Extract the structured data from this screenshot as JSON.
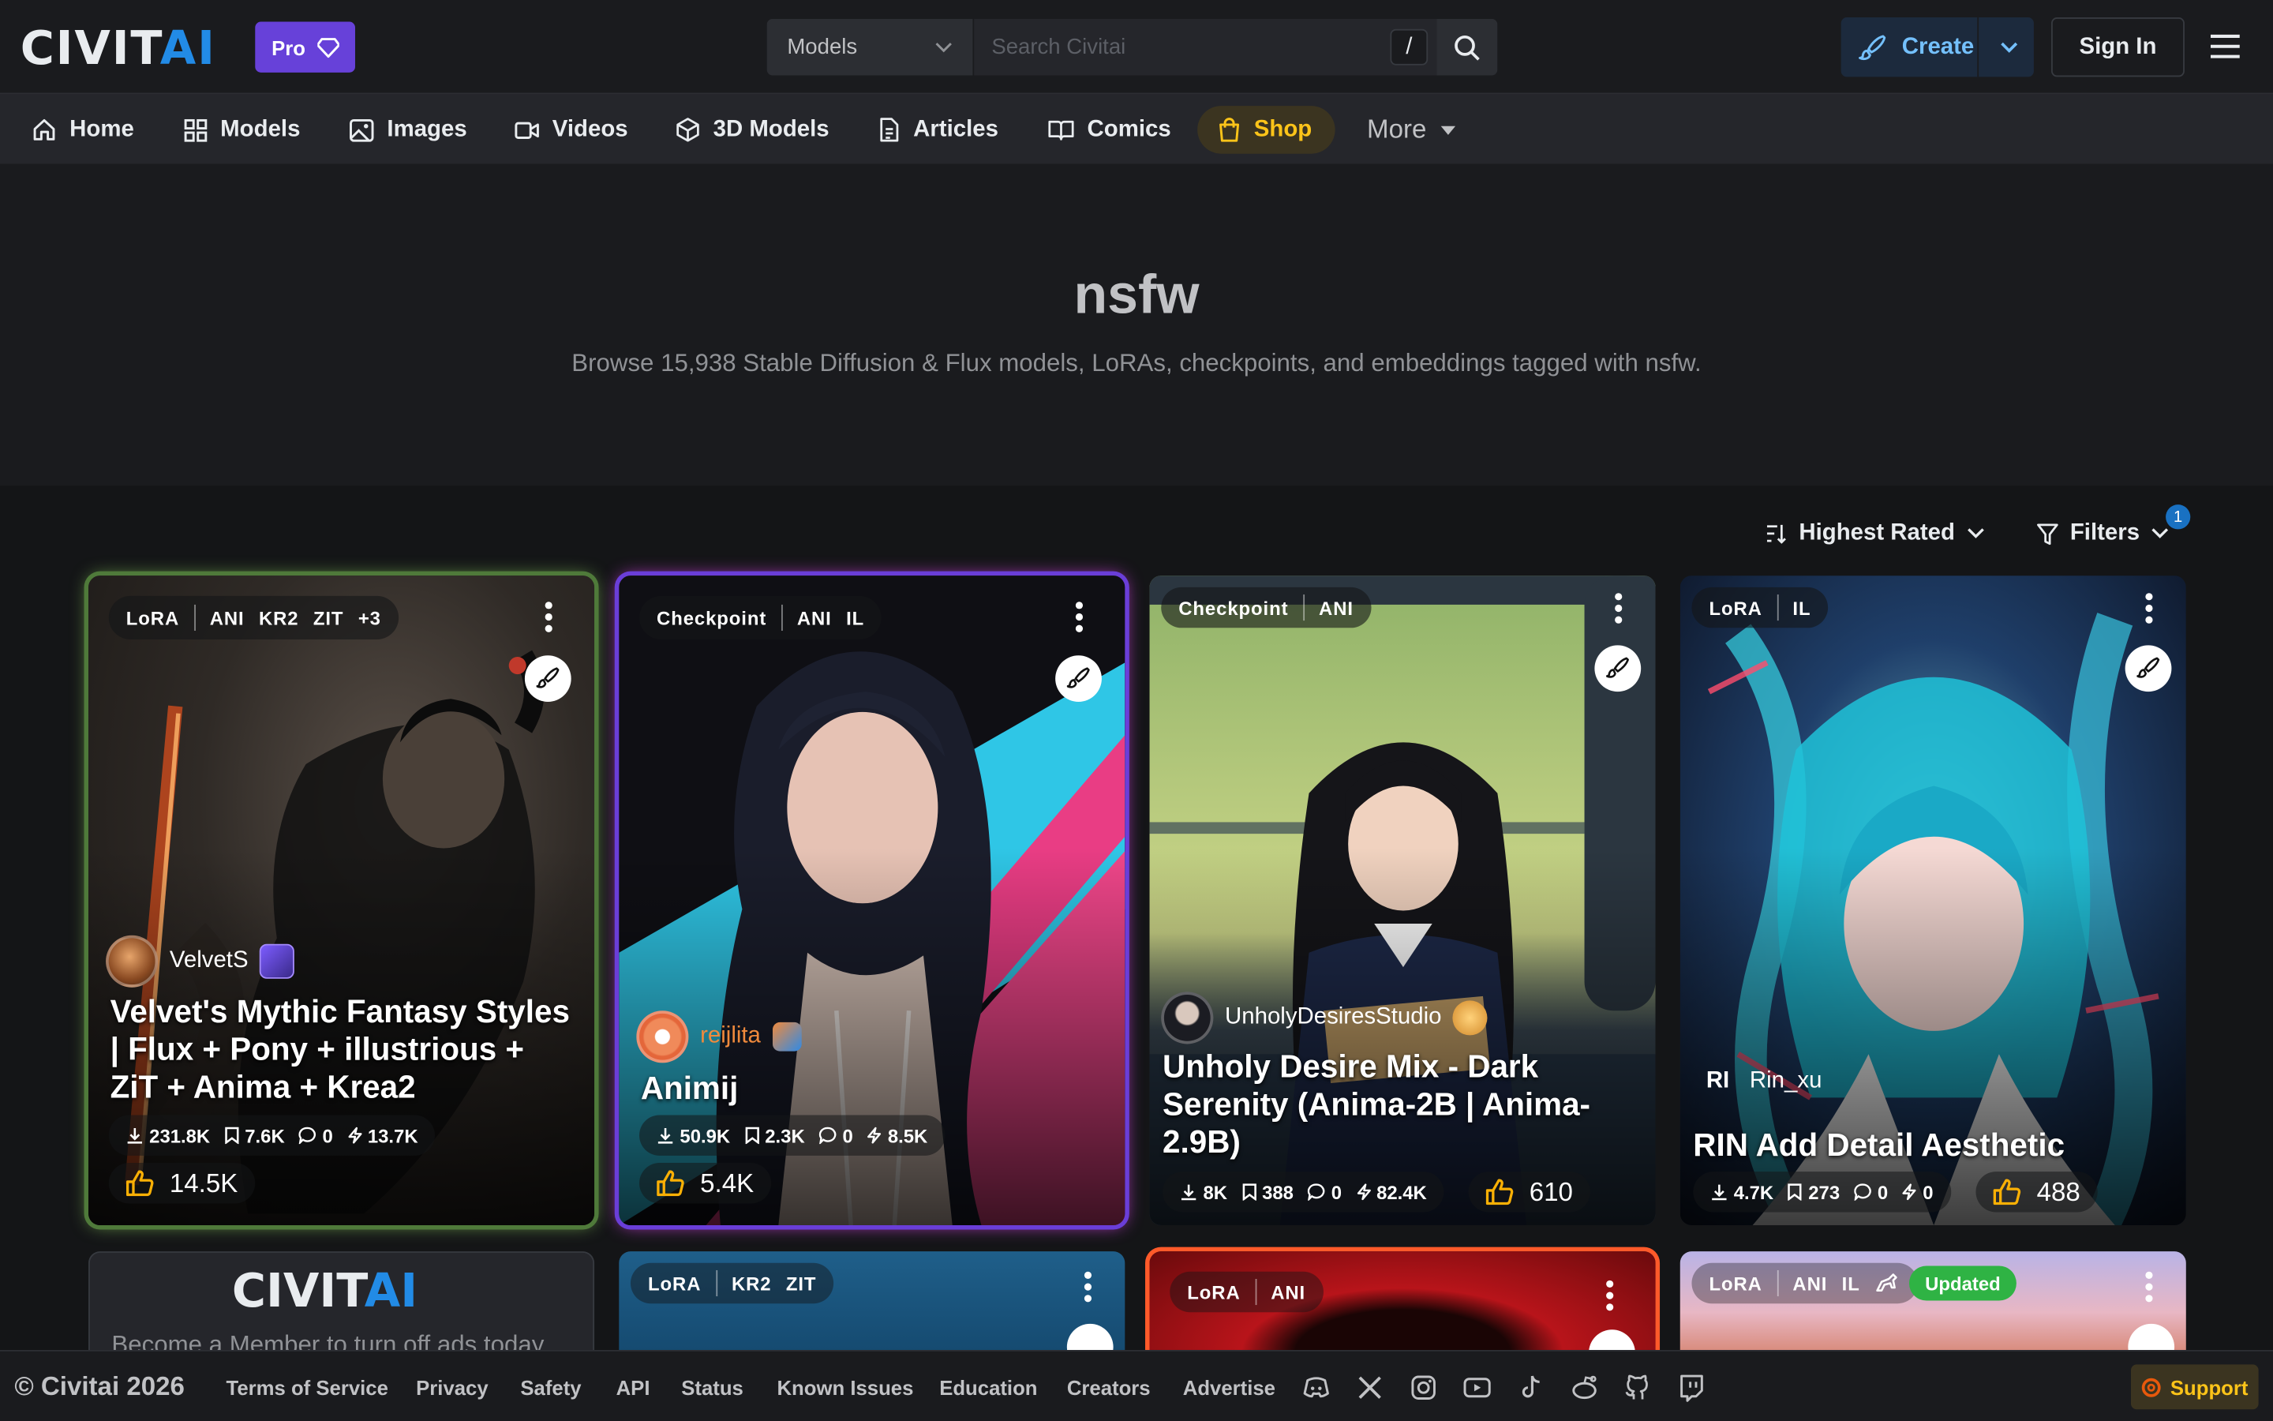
{
  "header": {
    "logo_left": "CIVIT",
    "logo_right": "AI",
    "pro_label": "Pro",
    "search_scope": "Models",
    "search_placeholder": "Search Civitai",
    "search_shortcut": "/",
    "create_label": "Create",
    "signin_label": "Sign In"
  },
  "nav": {
    "items": [
      {
        "label": "Home",
        "icon": "home-icon"
      },
      {
        "label": "Models",
        "icon": "grid-icon"
      },
      {
        "label": "Images",
        "icon": "image-icon"
      },
      {
        "label": "Videos",
        "icon": "video-icon"
      },
      {
        "label": "3D Models",
        "icon": "cube-icon"
      },
      {
        "label": "Articles",
        "icon": "article-icon"
      },
      {
        "label": "Comics",
        "icon": "book-icon"
      },
      {
        "label": "Shop",
        "icon": "shopping-bag-icon"
      }
    ],
    "more_label": "More"
  },
  "hero": {
    "title": "nsfw",
    "subtitle": "Browse 15,938 Stable Diffusion & Flux models, LoRAs, checkpoints, and embeddings tagged with nsfw."
  },
  "toolbar": {
    "sort_label": "Highest Rated",
    "filters_label": "Filters",
    "filters_count": "1"
  },
  "colors": {
    "accent": "#228be6",
    "pro": "#6741d9",
    "shop": "#fcc419",
    "like": "#fab005"
  },
  "cards": [
    {
      "type": "LoRA",
      "bases": [
        "ANI",
        "KR2",
        "ZIT",
        "+3"
      ],
      "creator": "VelvetS",
      "title": "Velvet's Mythic Fantasy Styles | Flux + Pony + illustrious + ZiT + Anima + Krea2",
      "downloads": "231.8K",
      "saves": "7.6K",
      "comments": "0",
      "buzz": "13.7K",
      "likes": "14.5K"
    },
    {
      "type": "Checkpoint",
      "bases": [
        "ANI",
        "IL"
      ],
      "creator": "reijlita",
      "title": "Animij",
      "downloads": "50.9K",
      "saves": "2.3K",
      "comments": "0",
      "buzz": "8.5K",
      "likes": "5.4K"
    },
    {
      "type": "Checkpoint",
      "bases": [
        "ANI"
      ],
      "creator": "UnholyDesiresStudio",
      "title": "Unholy Desire Mix - Dark Serenity (Anima-2B | Anima-2.9B)",
      "downloads": "8K",
      "saves": "388",
      "comments": "0",
      "buzz": "82.4K",
      "likes": "610"
    },
    {
      "type": "LoRA",
      "bases": [
        "IL"
      ],
      "creator": "Rin_xu",
      "creator_prefix": "RI",
      "title": "RIN Add Detail Aesthetic",
      "downloads": "4.7K",
      "saves": "273",
      "comments": "0",
      "buzz": "0",
      "likes": "488"
    }
  ],
  "row2": {
    "ad_text": "Become a Member to turn off ads today.",
    "card2_tags": [
      "LoRA",
      "KR2",
      "ZIT"
    ],
    "card3_tags": [
      "LoRA",
      "ANI"
    ],
    "card4_tags": [
      "LoRA",
      "ANI",
      "IL"
    ],
    "card4_badge": "Updated"
  },
  "footer": {
    "copyright": "© Civitai 2026",
    "links": [
      "Terms of Service",
      "Privacy",
      "Safety",
      "API",
      "Status",
      "Known Issues",
      "Education",
      "Creators",
      "Advertise"
    ],
    "social_icons": [
      "discord-icon",
      "x-icon",
      "instagram-icon",
      "youtube-icon",
      "tiktok-icon",
      "reddit-icon",
      "github-icon",
      "twitch-icon"
    ],
    "support_label": "Support"
  }
}
